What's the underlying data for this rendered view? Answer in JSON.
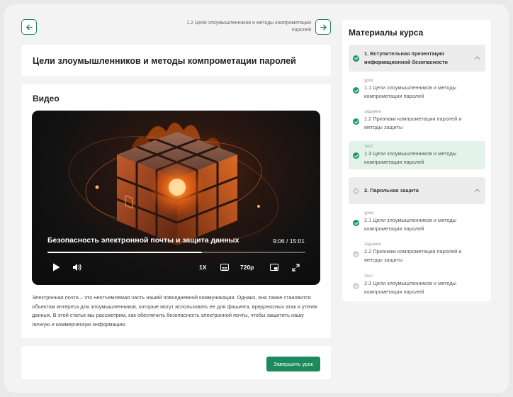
{
  "nav": {
    "next_lesson_title": "1.2 Цели злоумышленников и методы компрометации паролей"
  },
  "page": {
    "title": "Цели злоумышленников и методы компрометации паролей"
  },
  "video_section": {
    "heading": "Видео",
    "video_title": "Безопасность электронной почты и защита данных",
    "time": "9:06 / 15:01",
    "progress_fraction": 0.6,
    "speed": "1X",
    "quality": "720p",
    "description": "Электронная почта – это неотъемлемая часть нашей повседневной коммуникации. Однако, она также становится объектом интереса для злоумышленников, которые могут использовать ее для фишинга, вредоносных атак и утечек данных. В этой статье мы рассмотрим, как обеспечить безопасность электронной почты, чтобы защитить нашу личную и коммерческую информацию."
  },
  "footer": {
    "finish_label": "Завершить урок"
  },
  "sidebar": {
    "title": "Материалы курса",
    "sections": [
      {
        "label": "1. Вступительная презентация информационной безопасности",
        "done": true,
        "lessons": [
          {
            "type": "урок",
            "name": "1.1 Цели злоумышленников и методы компрометации паролей",
            "done": true,
            "active": false
          },
          {
            "type": "задание",
            "name": "1.2 Признаки компрометации паролей и методы защиты",
            "done": true,
            "active": false
          },
          {
            "type": "тест",
            "name": "1.3 Цели злоумышленников и методы компрометации паролей",
            "done": true,
            "active": true
          }
        ]
      },
      {
        "label": "2. Парольная защита",
        "done": false,
        "lessons": [
          {
            "type": "урок",
            "name": "2.1 Цели злоумышленников и методы компрометации паролей",
            "done": true,
            "active": false
          },
          {
            "type": "задание",
            "name": "2.2 Признаки компрометации паролей и методы защиты",
            "done": false,
            "active": false
          },
          {
            "type": "тест",
            "name": "2.3 Цели злоумышленников и методы компрометации паролей",
            "done": false,
            "active": false
          }
        ]
      }
    ]
  },
  "colors": {
    "accent": "#1d8a5e",
    "done": "#1d9a5e",
    "todo": "#cfcfd1",
    "active_bg": "#e3f3ea"
  }
}
